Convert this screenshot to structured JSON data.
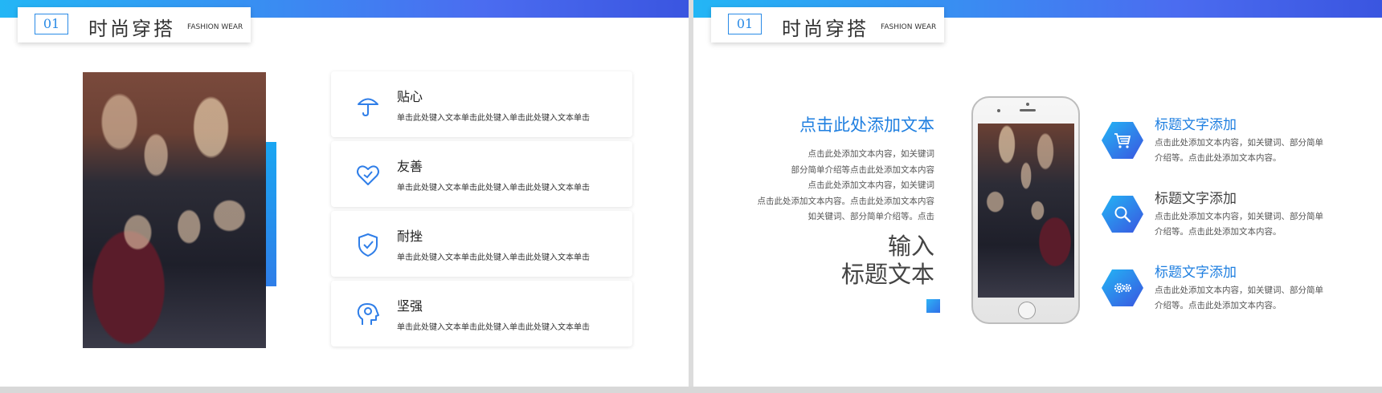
{
  "left": {
    "header": {
      "number": "01",
      "title": "时尚穿搭",
      "subtitle": "FASHION WEAR"
    },
    "features": [
      {
        "icon": "umbrella-icon",
        "title": "贴心",
        "desc": "单击此处键入文本单击此处键入单击此处键入文本单击"
      },
      {
        "icon": "heart-icon",
        "title": "友善",
        "desc": "单击此处键入文本单击此处键入单击此处键入文本单击"
      },
      {
        "icon": "shield-check-icon",
        "title": "耐挫",
        "desc": "单击此处键入文本单击此处键入单击此处键入文本单击"
      },
      {
        "icon": "head-gear-icon",
        "title": "坚强",
        "desc": "单击此处键入文本单击此处键入单击此处键入文本单击"
      }
    ]
  },
  "right": {
    "header": {
      "number": "01",
      "title": "时尚穿搭",
      "subtitle": "FASHION WEAR"
    },
    "heading": "点击此处添加文本",
    "paragraph": [
      "点击此处添加文本内容，如关键词",
      "部分简单介绍等点击此处添加文本内容",
      "点击此处添加文本内容，如关键词",
      "点击此处添加文本内容。点击此处添加文本内容",
      "如关键词、部分简单介绍等。点击"
    ],
    "big_title": [
      "输入",
      "标题文本"
    ],
    "items": [
      {
        "icon": "cart-icon",
        "title": "标题文字添加",
        "title_color": "#1f7fe0",
        "desc": [
          "点击此处添加文本内容，如关键词、部分简单",
          "介绍等。点击此处添加文本内容。"
        ]
      },
      {
        "icon": "search-icon",
        "title": "标题文字添加",
        "title_color": "#444444",
        "desc": [
          "点击此处添加文本内容，如关键词、部分简单",
          "介绍等。点击此处添加文本内容。"
        ]
      },
      {
        "icon": "gears-icon",
        "title": "标题文字添加",
        "title_color": "#1f7fe0",
        "desc": [
          "点击此处添加文本内容，如关键词、部分简单",
          "介绍等。点击此处添加文本内容。"
        ]
      }
    ]
  },
  "colors": {
    "accent": "#1f7fe0",
    "gradient_start": "#23b6f5",
    "gradient_end": "#3a55e0"
  }
}
